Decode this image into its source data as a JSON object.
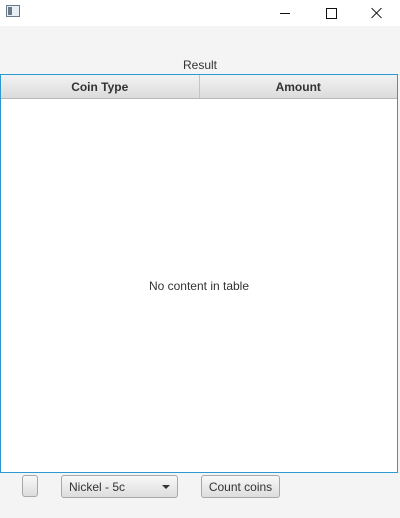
{
  "window": {
    "minimize_icon": "minimize-icon",
    "maximize_icon": "maximize-icon",
    "close_icon": "close-icon"
  },
  "result_label": "Result",
  "table": {
    "columns": [
      "Coin Type",
      "Amount"
    ],
    "rows": [],
    "placeholder": "No content in table",
    "border_color": "#2a9ad1"
  },
  "toolbar": {
    "coin_select": {
      "selected": "Nickel - 5c"
    },
    "count_button_label": "Count coins"
  }
}
